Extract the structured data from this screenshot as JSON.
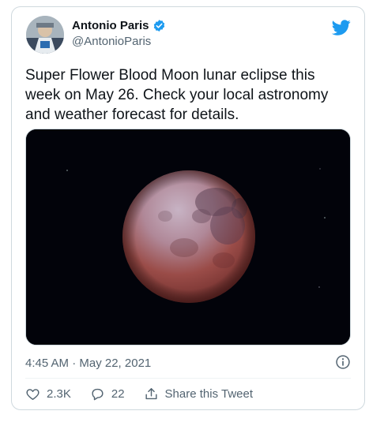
{
  "author": {
    "name": "Antonio Paris",
    "handle": "@AntonioParis"
  },
  "tweet": {
    "text": "Super Flower Blood Moon lunar eclipse this week on May 26. Check your local astronomy and weather forecast for details.",
    "timestamp": "4:45 AM · May 22, 2021"
  },
  "actions": {
    "likes": "2.3K",
    "replies": "22",
    "share_label": "Share this Tweet"
  },
  "colors": {
    "twitter_blue": "#1d9bf0",
    "moon_red": "#8b3a36",
    "moon_purple": "#b59fb0"
  },
  "icons": {
    "verified": "verified-badge-icon",
    "bird": "twitter-bird-icon",
    "info": "info-icon",
    "like": "heart-icon",
    "reply": "reply-icon",
    "share": "share-icon"
  }
}
